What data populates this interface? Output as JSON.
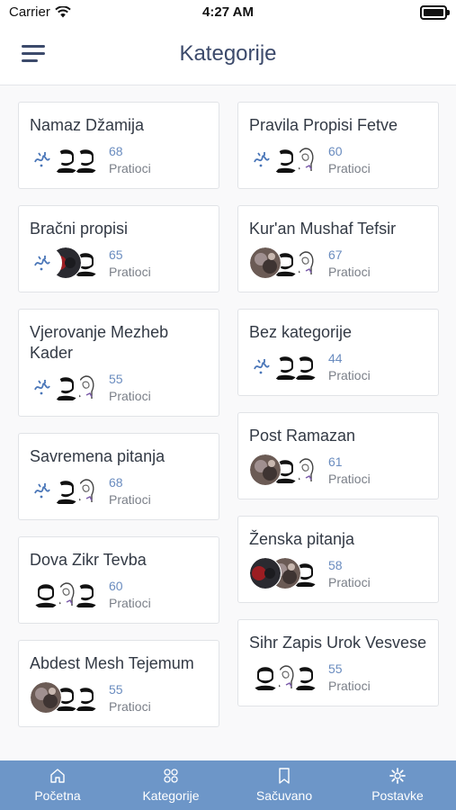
{
  "status": {
    "carrier": "Carrier",
    "time": "4:27 AM"
  },
  "header": {
    "title": "Kategorije"
  },
  "followers_label": "Pratioci",
  "left_column": [
    {
      "title": "Namaz Džamija",
      "count": "68",
      "avatars": [
        "calligraphy",
        "man",
        "man"
      ]
    },
    {
      "title": "Bračni propisi",
      "count": "65",
      "avatars": [
        "calligraphy",
        "dark-red",
        "man"
      ]
    },
    {
      "title": "Vjerovanje Mezheb Kader",
      "count": "55",
      "avatars": [
        "calligraphy",
        "man",
        "woman"
      ]
    },
    {
      "title": "Savremena pitanja",
      "count": "68",
      "avatars": [
        "calligraphy",
        "man",
        "woman"
      ]
    },
    {
      "title": "Dova Zikr Tevba",
      "count": "60",
      "avatars": [
        "man",
        "woman",
        "man"
      ]
    },
    {
      "title": "Abdest Mesh Tejemum",
      "count": "55",
      "avatars": [
        "photo",
        "man",
        "man"
      ]
    }
  ],
  "right_column": [
    {
      "title": "Pravila Propisi Fetve",
      "count": "60",
      "avatars": [
        "calligraphy",
        "man",
        "woman"
      ]
    },
    {
      "title": "Kur'an Mushaf Tefsir",
      "count": "67",
      "avatars": [
        "photo",
        "man",
        "woman"
      ]
    },
    {
      "title": "Bez kategorije",
      "count": "44",
      "avatars": [
        "calligraphy",
        "man",
        "man"
      ]
    },
    {
      "title": "Post Ramazan",
      "count": "61",
      "avatars": [
        "photo",
        "man",
        "woman"
      ]
    },
    {
      "title": "Ženska pitanja",
      "count": "58",
      "avatars": [
        "dark-red",
        "photo",
        "man"
      ]
    },
    {
      "title": "Sihr Zapis Urok Vesvese",
      "count": "55",
      "avatars": [
        "man",
        "woman",
        "man"
      ]
    }
  ],
  "tabs": [
    {
      "label": "Početna",
      "icon": "home-icon"
    },
    {
      "label": "Kategorije",
      "icon": "grid-icon"
    },
    {
      "label": "Sačuvano",
      "icon": "bookmark-icon"
    },
    {
      "label": "Postavke",
      "icon": "gear-icon"
    }
  ],
  "colors": {
    "accent": "#6d96c8",
    "count": "#6a8cbf",
    "title": "#3c4a6b"
  }
}
